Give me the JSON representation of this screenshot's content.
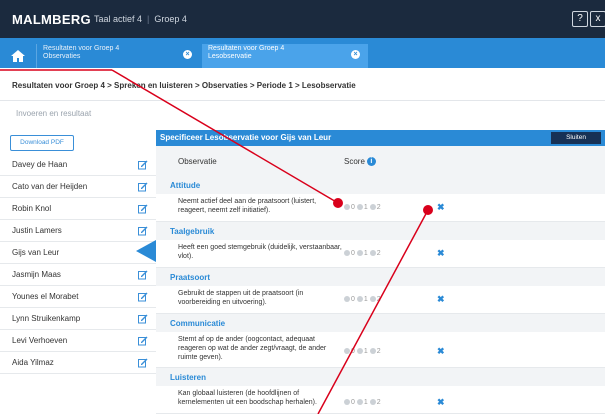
{
  "app": {
    "logo": "MALMBERG",
    "product": "Taal actief 4",
    "group": "Groep 4",
    "help_label": "?",
    "close_label": "x"
  },
  "tabs": [
    {
      "line1": "Resultaten voor Groep 4",
      "line2": "Observaties"
    },
    {
      "line1": "Resultaten voor Groep 4",
      "line2": "Lesobservatie"
    }
  ],
  "breadcrumb": "Resultaten voor Groep 4 > Spreken en luisteren > Observaties > Periode 1 > Lesobservatie",
  "subtitle": "Invoeren en resultaat",
  "sidebar": {
    "pdf_button": "Download PDF",
    "students": [
      "Davey de Haan",
      "Cato van der Heijden",
      "Robin Knol",
      "Justin Lamers",
      "Gijs van Leur",
      "Jasmijn Maas",
      "Younes el Morabet",
      "Lynn Struikenkamp",
      "Levi Verhoeven",
      "Aida Yilmaz"
    ]
  },
  "panel": {
    "title": "Specificeer Lesobservatie voor Gijs van Leur",
    "close_button": "Sluiten",
    "col_observatie": "Observatie",
    "col_score": "Score",
    "score_labels": [
      "0",
      "1",
      "2"
    ],
    "categories": [
      "Attitude",
      "Taalgebruik",
      "Praatsoort",
      "Communicatie",
      "Luisteren"
    ],
    "rows": [
      "Neemt actief deel aan de praatsoort (luistert, reageert, neemt zelf initiatief).",
      "Heeft een goed stemgebruik (duidelijk, verstaanbaar, vlot).",
      "Gebruikt de stappen uit de praatsoort (in voorbereiding en uitvoering).",
      "Stemt af op de ander (oogcontact, adequaat reageren op wat de ander zegt/vraagt, de ander ruimte geven).",
      "Kan globaal luisteren (de hoofdlijnen of kernelementen uit een boodschap herhalen)."
    ]
  },
  "colors": {
    "topbar": "#1b2a3e",
    "accent": "#2a8ad6",
    "annotation": "#d9001b"
  }
}
